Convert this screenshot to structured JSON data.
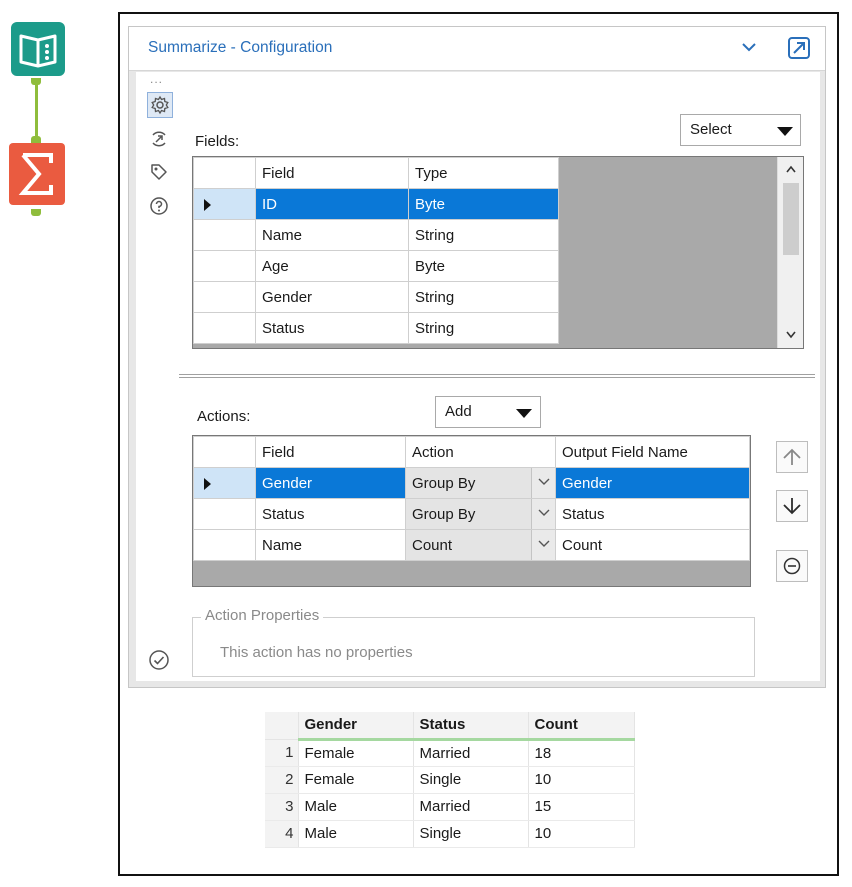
{
  "config": {
    "title": "Summarize - Configuration",
    "dots": "...",
    "fields_label": "Fields:",
    "select_label": "Select",
    "actions_label": "Actions:",
    "add_label": "Add",
    "fields_grid": {
      "headers": [
        "Field",
        "Type"
      ],
      "rows": [
        {
          "field": "ID",
          "type": "Byte",
          "selected": true
        },
        {
          "field": "Name",
          "type": "String"
        },
        {
          "field": "Age",
          "type": "Byte"
        },
        {
          "field": "Gender",
          "type": "String"
        },
        {
          "field": "Status",
          "type": "String"
        }
      ]
    },
    "actions_grid": {
      "headers": [
        "Field",
        "Action",
        "Output Field Name"
      ],
      "rows": [
        {
          "field": "Gender",
          "action": "Group By",
          "output": "Gender",
          "selected": true
        },
        {
          "field": "Status",
          "action": "Group By",
          "output": "Status"
        },
        {
          "field": "Name",
          "action": "Count",
          "output": "Count"
        }
      ]
    },
    "action_properties": {
      "legend": "Action Properties",
      "message": "This action has no properties"
    }
  },
  "results": {
    "headers": [
      "Gender",
      "Status",
      "Count"
    ],
    "rows": [
      {
        "n": "1",
        "gender": "Female",
        "status": "Married",
        "count": "18"
      },
      {
        "n": "2",
        "gender": "Female",
        "status": "Single",
        "count": "10"
      },
      {
        "n": "3",
        "gender": "Male",
        "status": "Married",
        "count": "15"
      },
      {
        "n": "4",
        "gender": "Male",
        "status": "Single",
        "count": "10"
      }
    ]
  },
  "colors": {
    "accent_blue": "#0a78d7",
    "title_blue": "#2a6fba",
    "book_teal": "#1c9b8a",
    "summarize_orange": "#ea5b40",
    "connector_green": "#8fbd3c"
  },
  "icons": [
    "book-input-icon",
    "summarize-sigma-icon",
    "gear-icon",
    "connection-icon",
    "tag-icon",
    "help-icon",
    "chevron-down-icon",
    "popout-icon",
    "arrow-up-icon",
    "arrow-down-icon",
    "remove-icon",
    "check-circle-icon"
  ]
}
